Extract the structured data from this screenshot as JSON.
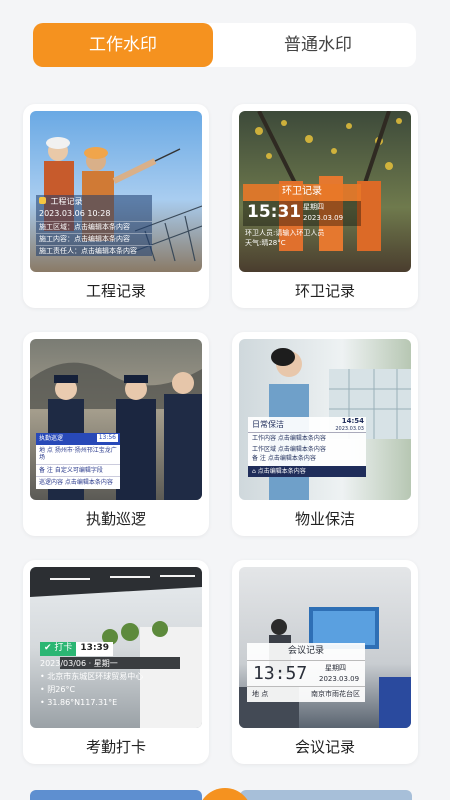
{
  "tabs": {
    "active": "工作水印",
    "inactive": "普通水印"
  },
  "cards": [
    {
      "label": "工程记录",
      "overlay": {
        "title": "工程记录",
        "datetime": "2023.03.06  10:28",
        "rows": [
          "施工区域：点击编辑本条内容",
          "施工内容：点击编辑本条内容",
          "施工责任人：点击编辑本条内容"
        ]
      }
    },
    {
      "label": "环卫记录",
      "overlay": {
        "title": "环卫记录",
        "time": "15:31",
        "weekday": "星期四",
        "date": "2023.03.09",
        "staff": "环卫人员:请输入环卫人员",
        "weather": "天气:晴28°C"
      }
    },
    {
      "label": "执勤巡逻",
      "overlay": {
        "title": "执勤巡逻",
        "time": "13:56",
        "rows": [
          "地  点  扬州市·扬州邗江宝龙广场",
          "备  注  自定义可编辑字段"
        ],
        "footer": "巡逻内容  点击编辑本条内容"
      }
    },
    {
      "label": "物业保洁",
      "overlay": {
        "title": "日常保洁",
        "time": "14:54",
        "date": "2023.03.03",
        "rows": [
          "工作内容  点击编辑本条内容",
          "工作区域  点击编辑本条内容",
          "备    注  点击编辑本条内容"
        ],
        "footer": "点击编辑本条内容"
      }
    },
    {
      "label": "考勤打卡",
      "overlay": {
        "badge": "打卡",
        "time": "13:39",
        "date": "2023/03/06 · 星期一",
        "location": "北京市东城区环球贸易中心",
        "weather": "阴26°C",
        "coords": "31.86°N117.31°E"
      }
    },
    {
      "label": "会议记录",
      "overlay": {
        "title": "会议记录",
        "time": "13:57",
        "weekday": "星期四",
        "date": "2023.03.09",
        "place_label": "地   点",
        "place": "南京市雨花台区"
      }
    }
  ]
}
